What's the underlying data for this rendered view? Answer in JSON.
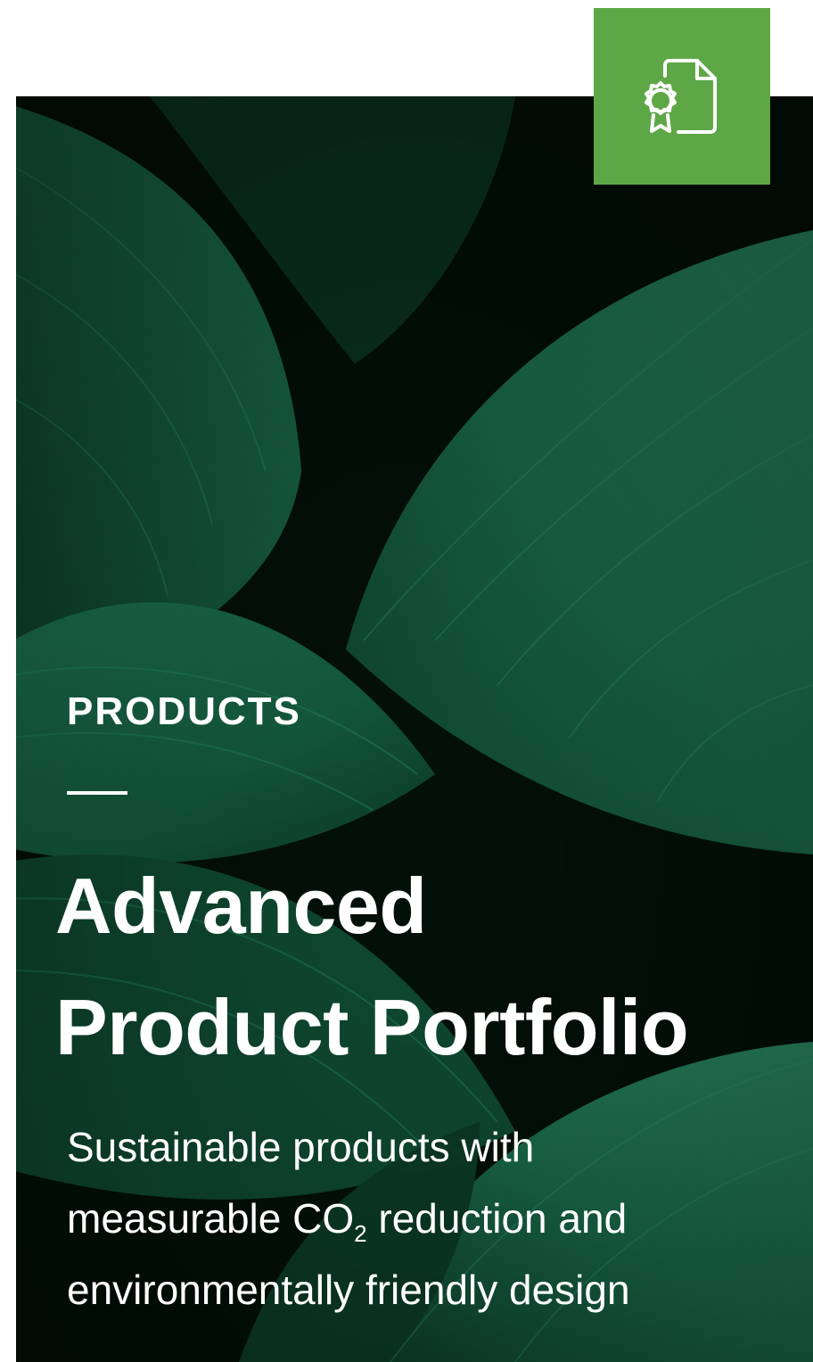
{
  "badge": {
    "icon": "certificate-document-icon",
    "color": "#5ea746"
  },
  "hero": {
    "background": "green-leaves-image",
    "eyebrow": "PRODUCTS",
    "title_line_1": "Advanced",
    "title_line_2": "Product Portfolio",
    "desc_line_1": "Sustainable products with",
    "desc_line_2_before": "measurable CO",
    "desc_line_2_sub": "2",
    "desc_line_2_after": " reduction and",
    "desc_line_3": "environmentally friendly design"
  }
}
